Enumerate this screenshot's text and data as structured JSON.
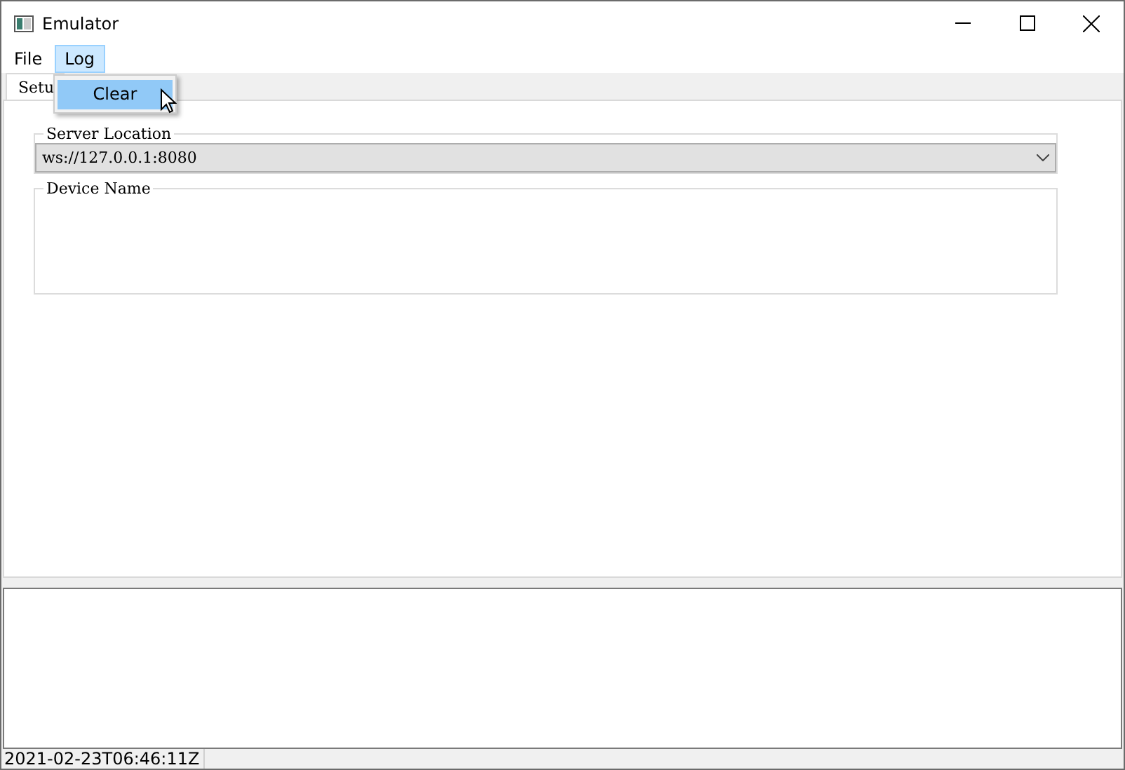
{
  "window": {
    "title": "Emulator"
  },
  "menu_bar": [
    {
      "label": "File",
      "selected": false
    },
    {
      "label": "Log",
      "selected": true
    }
  ],
  "open_menu": {
    "items": [
      {
        "label": "Clear",
        "selected": true
      }
    ]
  },
  "tabs": [
    {
      "label": "Setu",
      "selected": true
    }
  ],
  "server_location": {
    "label": "Server Location",
    "value": "ws://127.0.0.1:8080"
  },
  "device_name": {
    "label": "Device Name"
  },
  "status_bar": {
    "text": "2021-02-23T06:46:11Z"
  }
}
